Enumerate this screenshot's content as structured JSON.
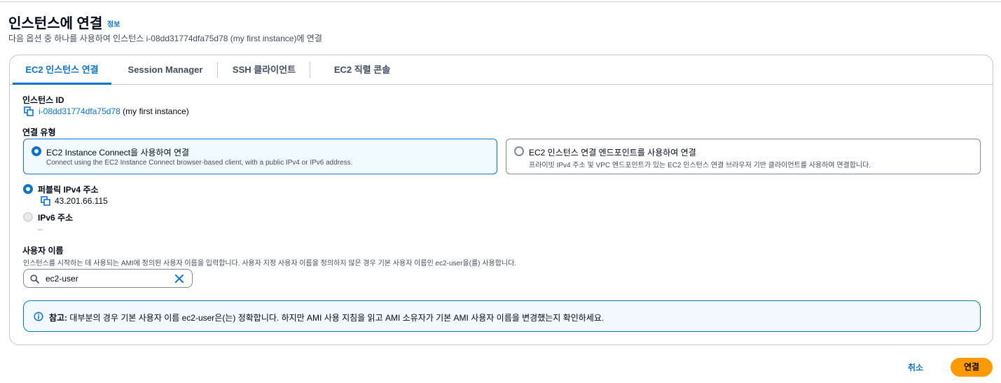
{
  "header": {
    "title": "인스턴스에 연결",
    "info_link": "정보",
    "subtitle": "다음 옵션 중 하나를 사용하여 인스턴스 i-08dd31774dfa75d78 (my first instance)에 연결"
  },
  "tabs": [
    {
      "label": "EC2 인스턴스 연결",
      "active": true
    },
    {
      "label": "Session Manager",
      "active": false
    },
    {
      "label": "SSH 클라이언트",
      "active": false
    },
    {
      "label": "EC2 직렬 콘솔",
      "active": false
    }
  ],
  "instance": {
    "label": "인스턴스 ID",
    "id": "i-08dd31774dfa75d78",
    "name": "(my first instance)"
  },
  "connection_type": {
    "label": "연결 유형",
    "options": [
      {
        "title": "EC2 Instance Connect을 사용하여 연결",
        "description": "Connect using the EC2 Instance Connect browser-based client, with a public IPv4 or IPv6 address.",
        "selected": true
      },
      {
        "title": "EC2 인스턴스 연결 엔드포인트를 사용하여 연결",
        "description": "프라이빗 IPv4 주소 및 VPC 엔드포인트가 있는 EC2 인스턴스 연결 브라우저 기반 클라이언트를 사용하여 연결합니다.",
        "selected": false
      }
    ]
  },
  "address": {
    "ipv4_label": "퍼블릭 IPv4 주소",
    "ipv4_value": "43.201.66.115",
    "ipv6_label": "IPv6 주소",
    "ipv6_value": "–"
  },
  "username": {
    "label": "사용자 이름",
    "hint": "인스턴스를 시작하는 데 사용되는 AMI에 정의된 사용자 이름을 입력합니다. 사용자 지정 사용자 이름을 정의하지 않은 경우 기본 사용자 이름인 ec2-user을(를) 사용합니다.",
    "value": "ec2-user"
  },
  "alert": {
    "bold": "참고:",
    "text": " 대부분의 경우 기본 사용자 이름 ec2-user은(는) 정확합니다. 하지만 AMI 사용 지침을 읽고 AMI 소유자가 기본 AMI 사용자 이름을 변경했는지 확인하세요."
  },
  "footer": {
    "cancel_label": "취소",
    "connect_label": "연결"
  },
  "colors": {
    "accent": "#0972d3",
    "primary_button": "#ff9900",
    "info_border": "#007eb9"
  }
}
